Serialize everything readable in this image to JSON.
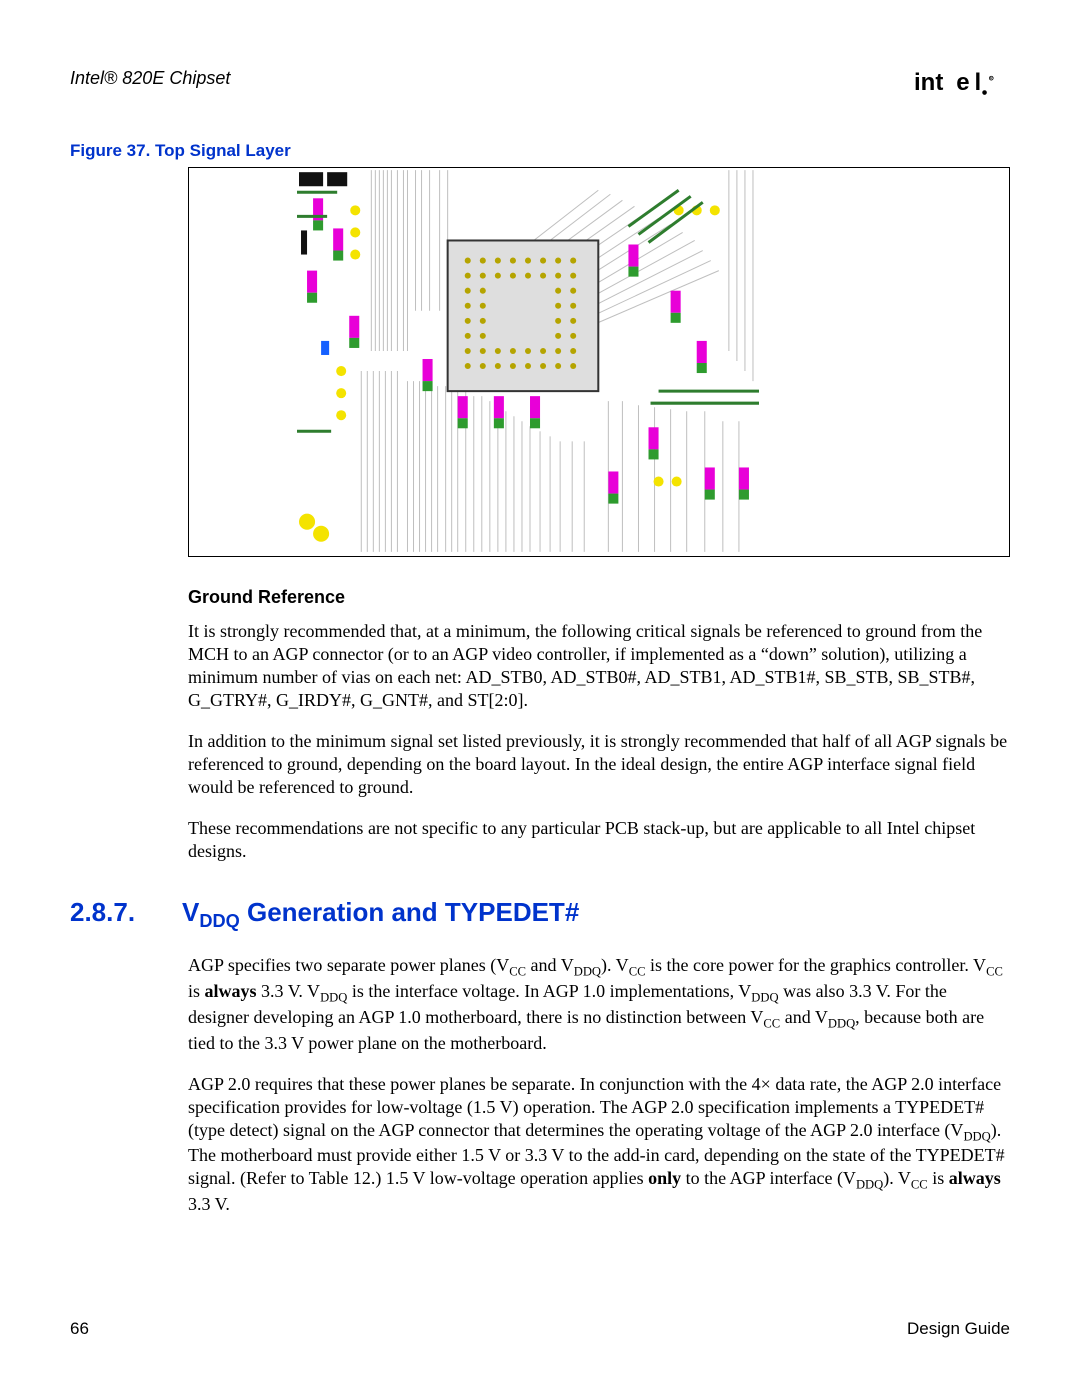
{
  "header": {
    "product": "Intel® 820E Chipset"
  },
  "figure": {
    "caption": "Figure 37. Top Signal Layer"
  },
  "ground_reference": {
    "title": "Ground Reference",
    "p1": "It is strongly recommended that, at a minimum, the following critical signals be referenced to ground from the MCH to an AGP connector (or to an AGP video controller, if implemented as a “down” solution), utilizing a minimum number of vias on each net: AD_STB0, AD_STB0#, AD_STB1, AD_STB1#, SB_STB, SB_STB#, G_GTRY#, G_IRDY#, G_GNT#, and ST[2:0].",
    "p2": "In addition to the minimum signal set listed previously, it is strongly recommended that half of all AGP signals be referenced to ground, depending on the board layout. In the ideal design, the entire AGP interface signal field would be referenced to ground.",
    "p3": "These recommendations are not specific to any particular PCB stack-up, but are applicable to all Intel chipset designs."
  },
  "section": {
    "number": "2.8.7.",
    "title_prefix": "V",
    "title_sub": "DDQ",
    "title_suffix": " Generation and TYPEDET#"
  },
  "vddq": {
    "p1_a": "AGP specifies two separate power planes (V",
    "p1_b": " and V",
    "p1_c": "). V",
    "p1_d": " is the core power for the graphics controller. V",
    "p1_e": " is ",
    "p1_always": "always",
    "p1_f": " 3.3 V. V",
    "p1_g": " is the interface voltage. In AGP 1.0 implementations, V",
    "p1_h": " was also 3.3 V. For the designer developing an AGP 1.0 motherboard, there is no distinction between V",
    "p1_i": " and V",
    "p1_j": ", because both are tied to the 3.3 V power plane on the motherboard.",
    "sub_cc": "CC",
    "sub_ddq": "DDQ",
    "p2_a": "AGP 2.0 requires that these power planes be separate. In conjunction with the 4× data rate, the AGP 2.0 interface specification provides for low-voltage (1.5 V) operation. The AGP 2.0 specification implements a TYPEDET# (type detect) signal on the AGP connector that determines the operating voltage of the AGP 2.0 interface (V",
    "p2_b": "). The motherboard must provide either 1.5 V or 3.3 V to the add-in card, depending on the state of the TYPEDET# signal. (Refer to Table 12.) 1.5 V low-voltage operation applies ",
    "p2_only": "only",
    "p2_c": " to the AGP interface (V",
    "p2_d": "). V",
    "p2_e": " is ",
    "p2_always2": "always",
    "p2_f": " 3.3 V."
  },
  "footer": {
    "page": "66",
    "doc": "Design Guide"
  }
}
